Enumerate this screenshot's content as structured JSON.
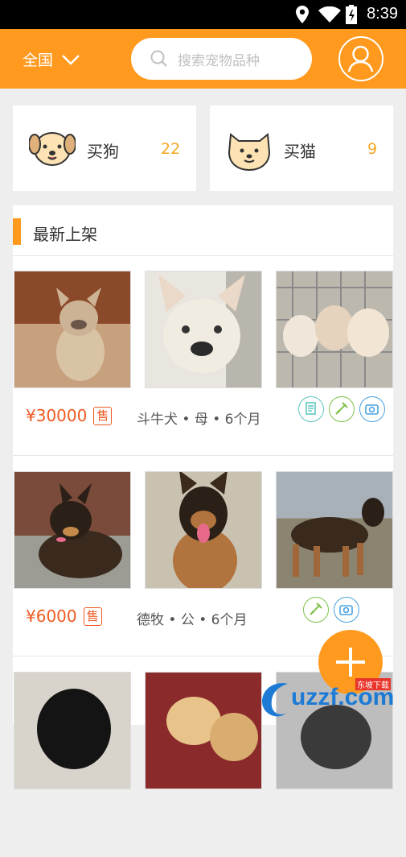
{
  "status_bar": {
    "time": "8:39"
  },
  "header": {
    "region_label": "全国",
    "search_placeholder": "搜索宠物品种"
  },
  "categories": [
    {
      "label": "买狗",
      "count": "22",
      "icon": "dog-face-icon"
    },
    {
      "label": "买猫",
      "count": "9",
      "icon": "cat-face-icon"
    }
  ],
  "section": {
    "title": "最新上架"
  },
  "listings": [
    {
      "price": "¥30000",
      "sale_tag": "售",
      "desc": "斗牛犬 • 母 • 6个月",
      "badges": [
        "document-icon",
        "vaccine-icon",
        "camera-icon"
      ],
      "photos": [
        "french-bulldog-sitting",
        "french-bulldog-closeup",
        "french-bulldog-puppies-cage"
      ]
    },
    {
      "price": "¥6000",
      "sale_tag": "售",
      "desc": "德牧 • 公 • 6个月",
      "badges": [
        "vaccine-icon",
        "camera-icon"
      ],
      "photos": [
        "german-shepherd-lying",
        "german-shepherd-portrait",
        "german-shepherd-standing"
      ]
    },
    {
      "photos": [
        "black-labrador-puppy",
        "golden-puppies",
        "dark-puppy"
      ]
    }
  ],
  "watermark": {
    "text": "uzzf.com",
    "tagline": "东坡下载"
  },
  "colors": {
    "accent": "#ff9a1f",
    "price": "#f05a22",
    "count": "#f5a623"
  }
}
